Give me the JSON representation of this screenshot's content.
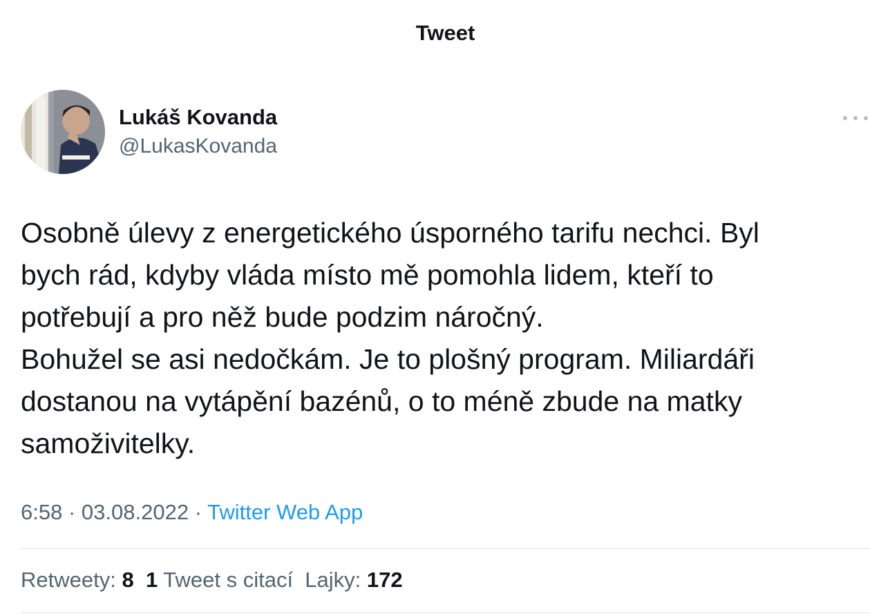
{
  "header": {
    "title": "Tweet"
  },
  "author": {
    "name": "Lukáš Kovanda",
    "handle": "@LukasKovanda",
    "avatar_icon": "profile-photo"
  },
  "tweet": {
    "lines": [
      "Osobně úlevy z energetického úsporného tarifu nechci. Byl",
      "bych rád, kdyby vláda místo mě pomohla lidem, kteří to",
      "potřebují a pro něž bude podzim náročný.",
      "Bohužel se asi nedočkám. Je to plošný program. Miliardáři",
      "dostanou na vytápění bazénů, o to méně zbude na matky",
      "samoživitelky."
    ],
    "time": "6:58",
    "separator": "·",
    "date": "03.08.2022",
    "source": "Twitter Web App"
  },
  "stats": {
    "retweets_label": "Retweety:",
    "retweets_count": "8",
    "quotes_count": "1",
    "quotes_label": "Tweet s citací",
    "likes_label": "Lajky:",
    "likes_count": "172"
  },
  "colors": {
    "text": "#0f1419",
    "secondary": "#536471",
    "link": "#1d9bf0",
    "divider": "#dfe3e7"
  }
}
